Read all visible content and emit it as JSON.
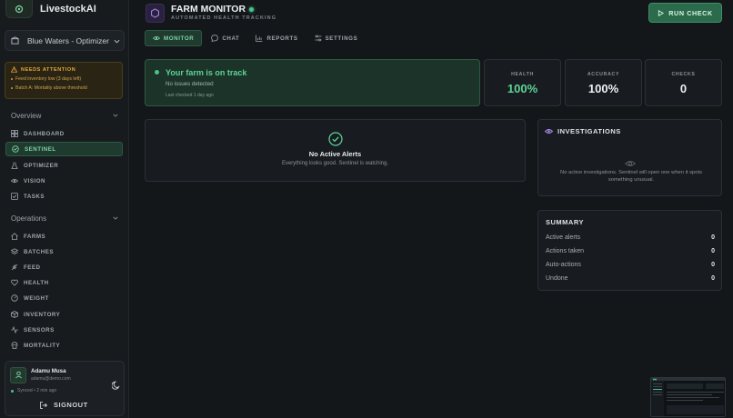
{
  "brand": {
    "name": "LivestockAI"
  },
  "farm_select": {
    "value": "Blue Waters - Optimizer"
  },
  "attention": {
    "title": "NEEDS ATTENTION",
    "items": [
      "Feed inventory low (3 days left)",
      "Batch A: Mortality above threshold"
    ]
  },
  "sidebar": {
    "overview_label": "Overview",
    "overview_items": [
      {
        "label": "DASHBOARD",
        "icon": "grid-icon"
      },
      {
        "label": "SENTINEL",
        "icon": "shield-icon"
      },
      {
        "label": "OPTIMIZER",
        "icon": "flask-icon"
      },
      {
        "label": "VISION",
        "icon": "eye-icon"
      },
      {
        "label": "TASKS",
        "icon": "checkbox-icon"
      }
    ],
    "operations_label": "Operations",
    "operations_items": [
      {
        "label": "FARMS",
        "icon": "home-icon"
      },
      {
        "label": "BATCHES",
        "icon": "layers-icon"
      },
      {
        "label": "FEED",
        "icon": "wheat-icon"
      },
      {
        "label": "HEALTH",
        "icon": "heart-icon"
      },
      {
        "label": "WEIGHT",
        "icon": "scale-icon"
      },
      {
        "label": "INVENTORY",
        "icon": "box-icon"
      },
      {
        "label": "SENSORS",
        "icon": "activity-icon"
      },
      {
        "label": "MORTALITY",
        "icon": "skull-icon"
      }
    ]
  },
  "user": {
    "name": "Adamu Musa",
    "email": "adamu@demo.com",
    "synced": "Synced • 2 min ago",
    "signout": "SIGNOUT"
  },
  "header": {
    "title": "FARM MONITOR",
    "subtitle": "AUTOMATED HEALTH TRACKING",
    "run_check": "RUN CHECK"
  },
  "tabs": [
    {
      "label": "MONITOR",
      "icon": "eye-icon"
    },
    {
      "label": "CHAT",
      "icon": "chat-icon"
    },
    {
      "label": "REPORTS",
      "icon": "bar-chart-icon"
    },
    {
      "label": "SETTINGS",
      "icon": "sliders-icon"
    }
  ],
  "status": {
    "title": "Your farm is on track",
    "subtitle": "No issues detected",
    "last_checked": "Last checked 1 day ago"
  },
  "metrics": [
    {
      "label": "HEALTH",
      "value": "100%"
    },
    {
      "label": "ACCURACY",
      "value": "100%"
    },
    {
      "label": "CHECKS",
      "value": "0"
    }
  ],
  "alerts": {
    "title": "No Active Alerts",
    "subtitle": "Everything looks good. Sentinel is watching."
  },
  "investigations": {
    "title": "INVESTIGATIONS",
    "message": "No active investigations. Sentinel will open one when it spots something unusual."
  },
  "summary": {
    "title": "SUMMARY",
    "rows": [
      {
        "label": "Active alerts",
        "value": "0"
      },
      {
        "label": "Actions taken",
        "value": "0"
      },
      {
        "label": "Auto-actions",
        "value": "0"
      },
      {
        "label": "Undone",
        "value": "0"
      }
    ]
  },
  "colors": {
    "accent_green": "#4cc38a",
    "warning": "#e3a93a",
    "purple": "#8b6cd9"
  }
}
